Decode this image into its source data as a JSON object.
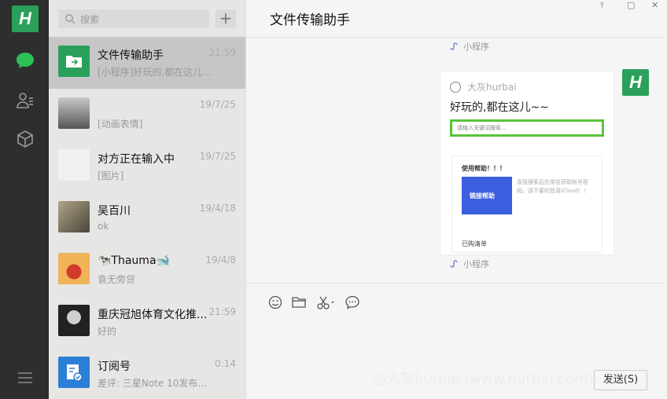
{
  "rail": {
    "avatar_letter": "H",
    "icons": [
      "chat-icon",
      "contacts-icon",
      "favorites-icon",
      "menu-icon"
    ]
  },
  "search": {
    "placeholder": "搜索"
  },
  "list": [
    {
      "name": "文件传输助手",
      "preview": "[小程序]好玩的,都在这儿...",
      "time": "21:59",
      "thumb_color": "#2aa05a"
    },
    {
      "name": "",
      "preview": "[动画表情]",
      "time": "19/7/25",
      "thumb_color": "#7a7a7a"
    },
    {
      "name": "对方正在输入中",
      "preview": "[图片]",
      "time": "19/7/25",
      "thumb_color": "#f1f1f1"
    },
    {
      "name": "吴百川",
      "preview": "ok",
      "time": "19/4/18",
      "thumb_color": "#6f6657"
    },
    {
      "name": "🐄Thauma🐋",
      "preview": "袁无旁贷",
      "time": "19/4/8",
      "thumb_color": "#e7a94b"
    },
    {
      "name": "重庆冠旭体育文化推...",
      "preview": "好的",
      "time": "21:59",
      "thumb_color": "#2f2f2f"
    },
    {
      "name": "订阅号",
      "preview": "差评: 三星Note 10发布...",
      "time": "0:14",
      "thumb_color": "#2b7fd6"
    }
  ],
  "chat": {
    "title": "文件传输助手",
    "mini_label": "小程序",
    "card": {
      "source": "大灰hurbai",
      "title": "好玩的,都在这儿~~",
      "search_placeholder": "请输入关键词搜索...",
      "panel_header": "使用帮助！！！",
      "panel_image_text": "链接帮助",
      "panel_text": "直接搜索后应用名获取账号密码。请不要的登录iCloud！！",
      "panel_footer": "已购清单"
    },
    "me_letter": "H",
    "send_label": "发送(S)",
    "watermark": "@大灰hurbai (www.hurbai.com)"
  }
}
